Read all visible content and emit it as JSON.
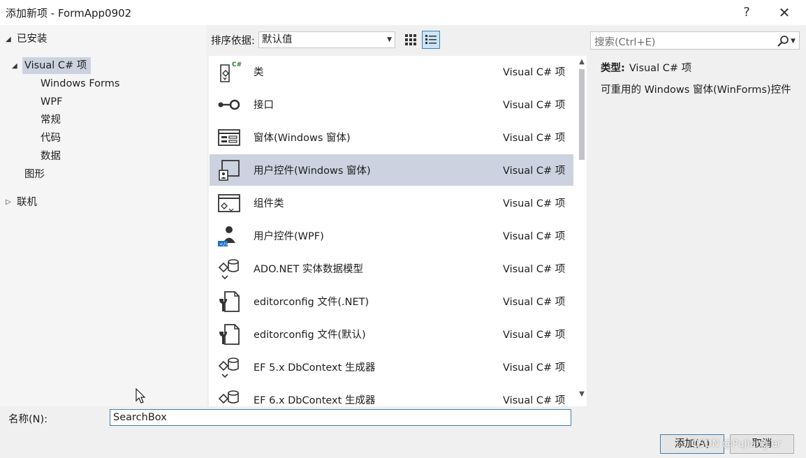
{
  "window": {
    "title": "添加新项 - FormApp0902",
    "help_label": "?",
    "close_label": "✕"
  },
  "tree": {
    "installed": "已安装",
    "visual_csharp": "Visual C# 项",
    "children": [
      "Windows Forms",
      "WPF",
      "常规",
      "代码",
      "数据"
    ],
    "graphics": "图形",
    "online": "联机"
  },
  "sortbar": {
    "label": "排序依据:",
    "selected": "默认值"
  },
  "search": {
    "placeholder": "搜索(Ctrl+E)"
  },
  "items": [
    {
      "name": "类",
      "lang": "Visual C# 项",
      "icon": "class-icon"
    },
    {
      "name": "接口",
      "lang": "Visual C# 项",
      "icon": "interface-icon"
    },
    {
      "name": "窗体(Windows 窗体)",
      "lang": "Visual C# 项",
      "icon": "form-icon"
    },
    {
      "name": "用户控件(Windows 窗体)",
      "lang": "Visual C# 项",
      "icon": "user-control-icon"
    },
    {
      "name": "组件类",
      "lang": "Visual C# 项",
      "icon": "component-icon"
    },
    {
      "name": "用户控件(WPF)",
      "lang": "Visual C# 项",
      "icon": "wpf-user-control-icon"
    },
    {
      "name": "ADO.NET 实体数据模型",
      "lang": "Visual C# 项",
      "icon": "entity-model-icon"
    },
    {
      "name": "editorconfig 文件(.NET)",
      "lang": "Visual C# 项",
      "icon": "config-file-icon"
    },
    {
      "name": "editorconfig 文件(默认)",
      "lang": "Visual C# 项",
      "icon": "config-file-icon"
    },
    {
      "name": "EF 5.x DbContext 生成器",
      "lang": "Visual C# 项",
      "icon": "ef-generator-icon"
    },
    {
      "name": "EF 6.x DbContext 生成器",
      "lang": "Visual C# 项",
      "icon": "ef-generator-icon"
    }
  ],
  "selected_index": 3,
  "info": {
    "type_label": "类型:",
    "type_value": "Visual C# 项",
    "description": "可重用的 Windows 窗体(WinForms)控件"
  },
  "name_field": {
    "label": "名称(N):",
    "value": "SearchBox"
  },
  "buttons": {
    "add": "添加(A)",
    "cancel": "取消"
  },
  "watermark": "CSDN @PuJiang.er",
  "colors": {
    "selection": "#cdd2e0",
    "focus_border": "#3c7fb1"
  }
}
